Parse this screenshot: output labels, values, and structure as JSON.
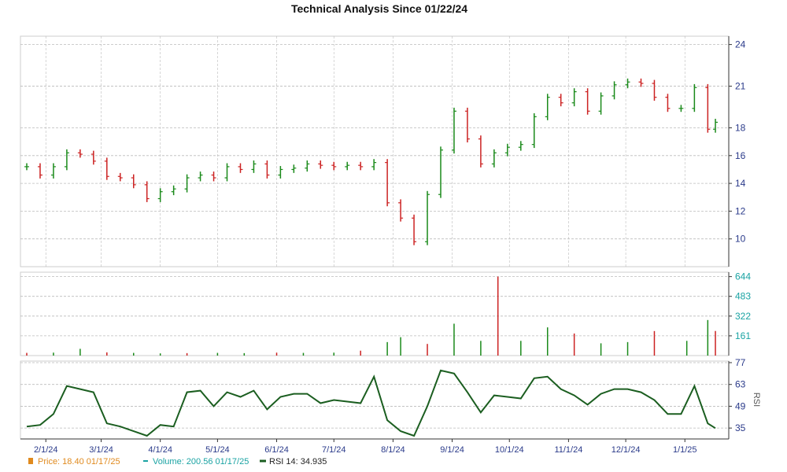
{
  "chart_data": {
    "type": "candlestick",
    "title": "Technical Analysis Since 01/22/24",
    "colors": {
      "up": "#1a8a1a",
      "down": "#cc2222",
      "rsi": "#1b5e20",
      "price_legend": "#e08a1e",
      "volume_legend": "#1aa3a3",
      "grid": "#bbbbbb",
      "axis_text": "#2a3a8a"
    },
    "grid": true,
    "price_axis": {
      "ylim": [
        8,
        24.6
      ],
      "ticks": [
        10,
        12,
        14,
        16,
        18,
        21,
        24
      ]
    },
    "volume_axis": {
      "ylim": [
        0,
        680
      ],
      "ticks": [
        161,
        322,
        483,
        644
      ]
    },
    "rsi_axis": {
      "ylim": [
        28,
        78
      ],
      "ticks": [
        35,
        49,
        63,
        77
      ],
      "label": "RSI"
    },
    "x_ticks": [
      {
        "date": "2024-02-01",
        "label": "2/1/24"
      },
      {
        "date": "2024-03-01",
        "label": "3/1/24"
      },
      {
        "date": "2024-04-01",
        "label": "4/1/24"
      },
      {
        "date": "2024-05-01",
        "label": "5/1/24"
      },
      {
        "date": "2024-06-01",
        "label": "6/1/24"
      },
      {
        "date": "2024-07-01",
        "label": "7/1/24"
      },
      {
        "date": "2024-08-01",
        "label": "8/1/24"
      },
      {
        "date": "2024-09-01",
        "label": "9/1/24"
      },
      {
        "date": "2024-10-01",
        "label": "10/1/24"
      },
      {
        "date": "2024-11-01",
        "label": "11/1/24"
      },
      {
        "date": "2024-12-01",
        "label": "12/1/24"
      },
      {
        "date": "2025-01-01",
        "label": "1/1/25"
      }
    ],
    "price_series": [
      {
        "date": "2024-01-22",
        "close": 15.2
      },
      {
        "date": "2024-01-29",
        "close": 14.6
      },
      {
        "date": "2024-02-05",
        "close": 15.2
      },
      {
        "date": "2024-02-12",
        "close": 16.2
      },
      {
        "date": "2024-02-19",
        "close": 16.1
      },
      {
        "date": "2024-02-26",
        "close": 15.6
      },
      {
        "date": "2024-03-04",
        "close": 14.5
      },
      {
        "date": "2024-03-11",
        "close": 14.4
      },
      {
        "date": "2024-03-18",
        "close": 13.9
      },
      {
        "date": "2024-03-25",
        "close": 12.9
      },
      {
        "date": "2024-04-01",
        "close": 13.4
      },
      {
        "date": "2024-04-08",
        "close": 13.6
      },
      {
        "date": "2024-04-15",
        "close": 14.4
      },
      {
        "date": "2024-04-22",
        "close": 14.6
      },
      {
        "date": "2024-04-29",
        "close": 14.4
      },
      {
        "date": "2024-05-06",
        "close": 15.2
      },
      {
        "date": "2024-05-13",
        "close": 15.0
      },
      {
        "date": "2024-05-20",
        "close": 15.4
      },
      {
        "date": "2024-05-27",
        "close": 14.6
      },
      {
        "date": "2024-06-03",
        "close": 15.0
      },
      {
        "date": "2024-06-10",
        "close": 15.1
      },
      {
        "date": "2024-06-17",
        "close": 15.4
      },
      {
        "date": "2024-06-24",
        "close": 15.3
      },
      {
        "date": "2024-07-01",
        "close": 15.2
      },
      {
        "date": "2024-07-08",
        "close": 15.3
      },
      {
        "date": "2024-07-15",
        "close": 15.2
      },
      {
        "date": "2024-07-22",
        "close": 15.5
      },
      {
        "date": "2024-07-29",
        "close": 12.6
      },
      {
        "date": "2024-08-05",
        "close": 11.5
      },
      {
        "date": "2024-08-12",
        "close": 9.8
      },
      {
        "date": "2024-08-19",
        "close": 13.2
      },
      {
        "date": "2024-08-26",
        "close": 16.4
      },
      {
        "date": "2024-09-02",
        "close": 19.2
      },
      {
        "date": "2024-09-09",
        "close": 17.2
      },
      {
        "date": "2024-09-16",
        "close": 15.4
      },
      {
        "date": "2024-09-23",
        "close": 16.2
      },
      {
        "date": "2024-09-30",
        "close": 16.6
      },
      {
        "date": "2024-10-07",
        "close": 16.8
      },
      {
        "date": "2024-10-14",
        "close": 18.8
      },
      {
        "date": "2024-10-21",
        "close": 20.2
      },
      {
        "date": "2024-10-28",
        "close": 19.8
      },
      {
        "date": "2024-11-04",
        "close": 20.6
      },
      {
        "date": "2024-11-11",
        "close": 19.2
      },
      {
        "date": "2024-11-18",
        "close": 20.3
      },
      {
        "date": "2024-11-25",
        "close": 21.1
      },
      {
        "date": "2024-12-02",
        "close": 21.3
      },
      {
        "date": "2024-12-09",
        "close": 21.2
      },
      {
        "date": "2024-12-16",
        "close": 20.2
      },
      {
        "date": "2024-12-23",
        "close": 19.4
      },
      {
        "date": "2024-12-30",
        "close": 19.4
      },
      {
        "date": "2025-01-06",
        "close": 20.9
      },
      {
        "date": "2025-01-13",
        "close": 17.9
      },
      {
        "date": "2025-01-17",
        "close": 18.4
      }
    ],
    "volume_series": [
      {
        "date": "2024-01-22",
        "volume": 22
      },
      {
        "date": "2024-02-05",
        "volume": 24
      },
      {
        "date": "2024-02-19",
        "volume": 55
      },
      {
        "date": "2024-03-04",
        "volume": 26
      },
      {
        "date": "2024-03-18",
        "volume": 22
      },
      {
        "date": "2024-04-01",
        "volume": 18
      },
      {
        "date": "2024-04-15",
        "volume": 20
      },
      {
        "date": "2024-05-01",
        "volume": 22
      },
      {
        "date": "2024-05-15",
        "volume": 20
      },
      {
        "date": "2024-06-01",
        "volume": 24
      },
      {
        "date": "2024-06-15",
        "volume": 22
      },
      {
        "date": "2024-07-01",
        "volume": 24
      },
      {
        "date": "2024-07-15",
        "volume": 40
      },
      {
        "date": "2024-07-29",
        "volume": 110
      },
      {
        "date": "2024-08-05",
        "volume": 150
      },
      {
        "date": "2024-08-19",
        "volume": 95
      },
      {
        "date": "2024-09-02",
        "volume": 260
      },
      {
        "date": "2024-09-16",
        "volume": 120
      },
      {
        "date": "2024-09-25",
        "volume": 644
      },
      {
        "date": "2024-10-07",
        "volume": 120
      },
      {
        "date": "2024-10-21",
        "volume": 230
      },
      {
        "date": "2024-11-04",
        "volume": 180
      },
      {
        "date": "2024-11-18",
        "volume": 100
      },
      {
        "date": "2024-12-02",
        "volume": 110
      },
      {
        "date": "2024-12-16",
        "volume": 200
      },
      {
        "date": "2025-01-02",
        "volume": 120
      },
      {
        "date": "2025-01-13",
        "volume": 290
      },
      {
        "date": "2025-01-17",
        "volume": 200.56
      }
    ],
    "rsi_series": [
      {
        "date": "2024-01-22",
        "rsi": 36
      },
      {
        "date": "2024-01-29",
        "rsi": 37
      },
      {
        "date": "2024-02-05",
        "rsi": 44
      },
      {
        "date": "2024-02-12",
        "rsi": 62
      },
      {
        "date": "2024-02-19",
        "rsi": 60
      },
      {
        "date": "2024-02-26",
        "rsi": 58
      },
      {
        "date": "2024-03-04",
        "rsi": 38
      },
      {
        "date": "2024-03-11",
        "rsi": 36
      },
      {
        "date": "2024-03-18",
        "rsi": 33
      },
      {
        "date": "2024-03-25",
        "rsi": 30
      },
      {
        "date": "2024-04-01",
        "rsi": 37
      },
      {
        "date": "2024-04-08",
        "rsi": 36
      },
      {
        "date": "2024-04-15",
        "rsi": 58
      },
      {
        "date": "2024-04-22",
        "rsi": 59
      },
      {
        "date": "2024-04-29",
        "rsi": 49
      },
      {
        "date": "2024-05-06",
        "rsi": 58
      },
      {
        "date": "2024-05-13",
        "rsi": 55
      },
      {
        "date": "2024-05-20",
        "rsi": 59
      },
      {
        "date": "2024-05-27",
        "rsi": 47
      },
      {
        "date": "2024-06-03",
        "rsi": 55
      },
      {
        "date": "2024-06-10",
        "rsi": 57
      },
      {
        "date": "2024-06-17",
        "rsi": 57
      },
      {
        "date": "2024-06-24",
        "rsi": 51
      },
      {
        "date": "2024-07-01",
        "rsi": 53
      },
      {
        "date": "2024-07-08",
        "rsi": 52
      },
      {
        "date": "2024-07-15",
        "rsi": 51
      },
      {
        "date": "2024-07-22",
        "rsi": 68
      },
      {
        "date": "2024-07-29",
        "rsi": 40
      },
      {
        "date": "2024-08-05",
        "rsi": 33
      },
      {
        "date": "2024-08-12",
        "rsi": 30
      },
      {
        "date": "2024-08-19",
        "rsi": 49
      },
      {
        "date": "2024-08-26",
        "rsi": 72
      },
      {
        "date": "2024-09-02",
        "rsi": 70
      },
      {
        "date": "2024-09-09",
        "rsi": 58
      },
      {
        "date": "2024-09-16",
        "rsi": 45
      },
      {
        "date": "2024-09-23",
        "rsi": 56
      },
      {
        "date": "2024-09-30",
        "rsi": 55
      },
      {
        "date": "2024-10-07",
        "rsi": 54
      },
      {
        "date": "2024-10-14",
        "rsi": 67
      },
      {
        "date": "2024-10-21",
        "rsi": 68
      },
      {
        "date": "2024-10-28",
        "rsi": 60
      },
      {
        "date": "2024-11-04",
        "rsi": 56
      },
      {
        "date": "2024-11-11",
        "rsi": 50
      },
      {
        "date": "2024-11-18",
        "rsi": 57
      },
      {
        "date": "2024-11-25",
        "rsi": 60
      },
      {
        "date": "2024-12-02",
        "rsi": 60
      },
      {
        "date": "2024-12-09",
        "rsi": 58
      },
      {
        "date": "2024-12-16",
        "rsi": 53
      },
      {
        "date": "2024-12-23",
        "rsi": 44
      },
      {
        "date": "2024-12-30",
        "rsi": 44
      },
      {
        "date": "2025-01-06",
        "rsi": 62
      },
      {
        "date": "2025-01-13",
        "rsi": 38
      },
      {
        "date": "2025-01-17",
        "rsi": 34.935
      }
    ],
    "legend": [
      {
        "key": "price",
        "label": "Price: 18.40  01/17/25"
      },
      {
        "key": "volume",
        "label": "Volume: 200.56  01/17/25"
      },
      {
        "key": "rsi",
        "label": "RSI 14: 34.935"
      }
    ]
  }
}
